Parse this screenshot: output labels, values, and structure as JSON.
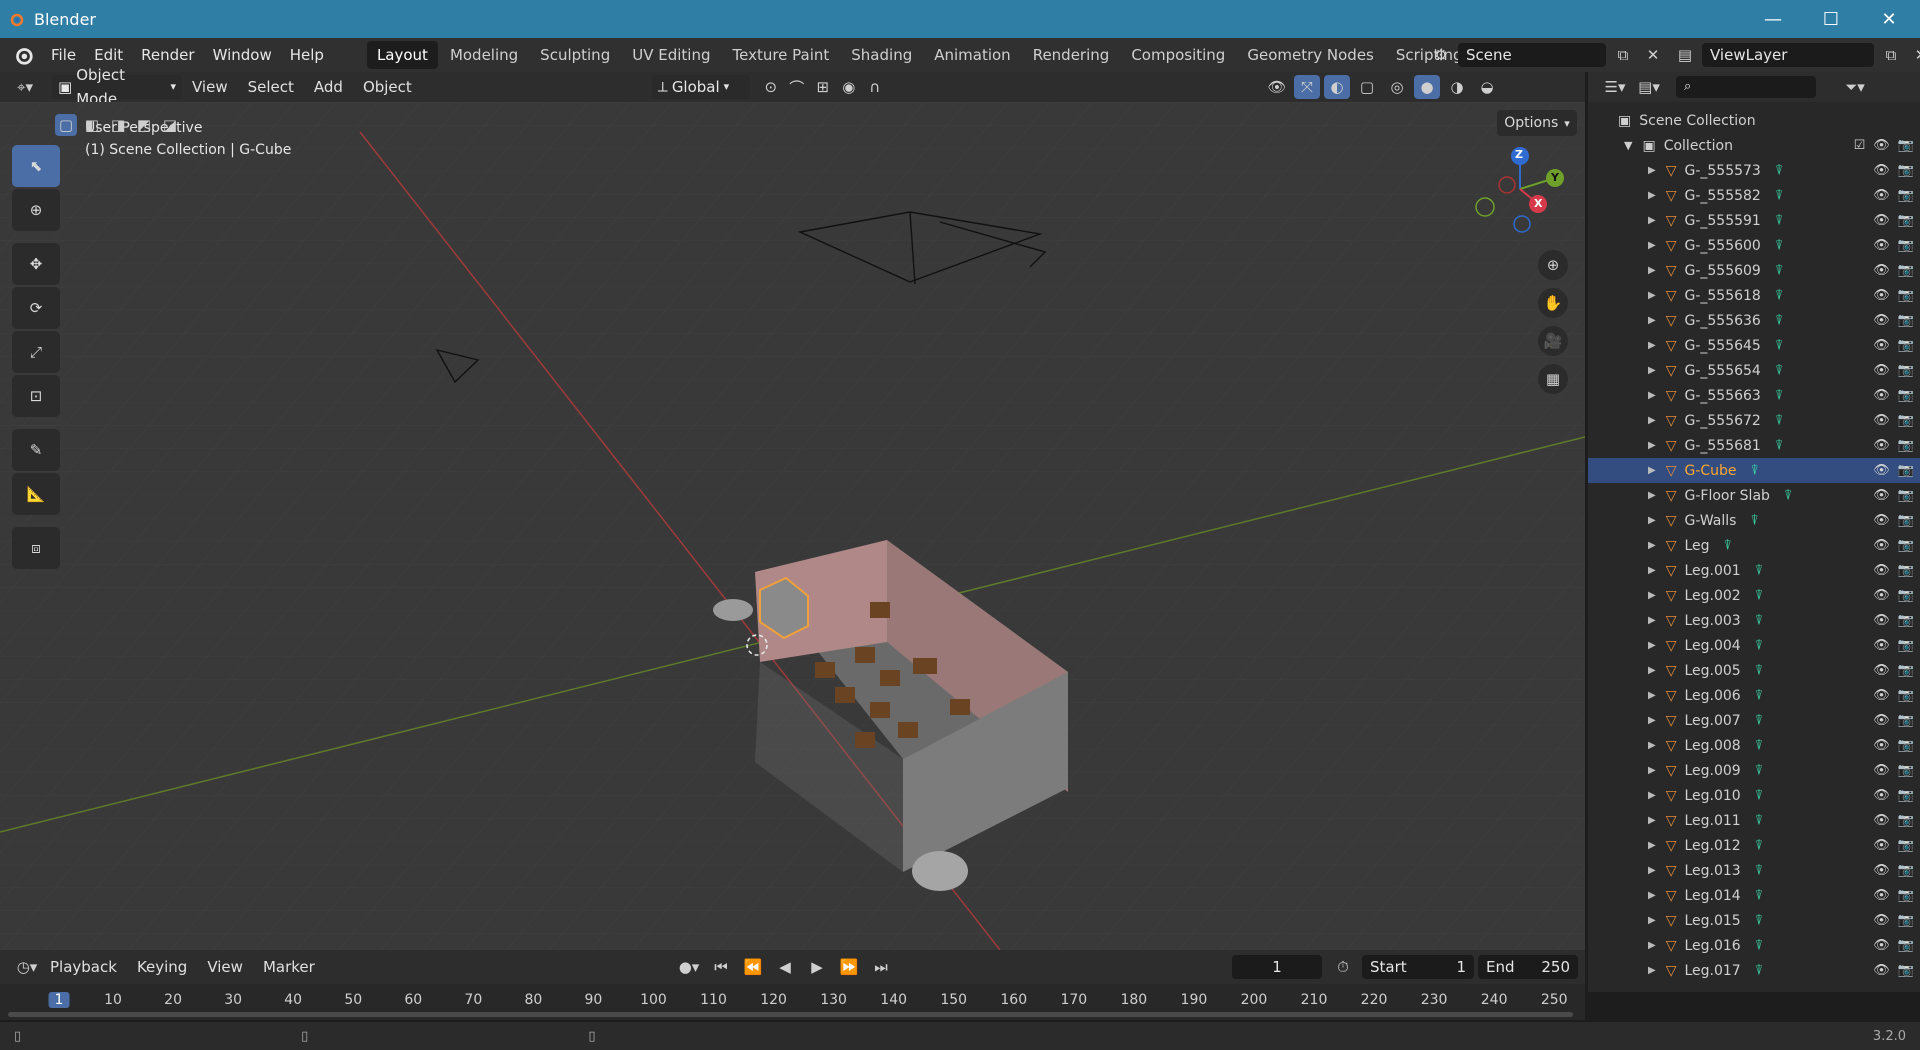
{
  "window": {
    "title": "Blender",
    "minimize": "—",
    "maximize": "☐",
    "close": "✕"
  },
  "menubar": {
    "menus": [
      "File",
      "Edit",
      "Render",
      "Window",
      "Help"
    ],
    "workspaces": [
      "Layout",
      "Modeling",
      "Sculpting",
      "UV Editing",
      "Texture Paint",
      "Shading",
      "Animation",
      "Rendering",
      "Compositing",
      "Geometry Nodes",
      "Scripting"
    ],
    "active_workspace": "Layout",
    "add_workspace": "+",
    "scene": "Scene",
    "view_layer": "ViewLayer"
  },
  "header3d": {
    "mode": "Object Mode",
    "menus": [
      "View",
      "Select",
      "Add",
      "Object"
    ],
    "orientation": "Global",
    "options": "Options"
  },
  "viewport": {
    "view_name": "User Perspective",
    "context": "(1) Scene Collection | G-Cube",
    "gizmo": {
      "z": "Z",
      "y": "Y",
      "x": "X"
    }
  },
  "outliner": {
    "scene_collection": "Scene Collection",
    "collection": "Collection",
    "items": [
      "G-_555573",
      "G-_555582",
      "G-_555591",
      "G-_555600",
      "G-_555609",
      "G-_555618",
      "G-_555636",
      "G-_555645",
      "G-_555654",
      "G-_555663",
      "G-_555672",
      "G-_555681",
      "G-Cube",
      "G-Floor Slab",
      "G-Walls",
      "Leg",
      "Leg.001",
      "Leg.002",
      "Leg.003",
      "Leg.004",
      "Leg.005",
      "Leg.006",
      "Leg.007",
      "Leg.008",
      "Leg.009",
      "Leg.010",
      "Leg.011",
      "Leg.012",
      "Leg.013",
      "Leg.014",
      "Leg.015",
      "Leg.016",
      "Leg.017"
    ],
    "selected": "G-Cube"
  },
  "timeline": {
    "menus": [
      "Playback",
      "Keying",
      "View",
      "Marker"
    ],
    "current_frame": "1",
    "start_label": "Start",
    "start": "1",
    "end_label": "End",
    "end": "250",
    "ticks": [
      "1",
      "10",
      "20",
      "30",
      "40",
      "50",
      "60",
      "70",
      "80",
      "90",
      "100",
      "110",
      "120",
      "130",
      "140",
      "150",
      "160",
      "170",
      "180",
      "190",
      "200",
      "210",
      "220",
      "230",
      "240",
      "250"
    ]
  },
  "statusbar": {
    "version": "3.2.0"
  },
  "colors": {
    "accent": "#4a6ea5",
    "selected_text": "#ffa62d",
    "titlebar": "#2f7ea5",
    "mesh_icon": "#e38c3b",
    "data_icon": "#3ad1a4"
  }
}
